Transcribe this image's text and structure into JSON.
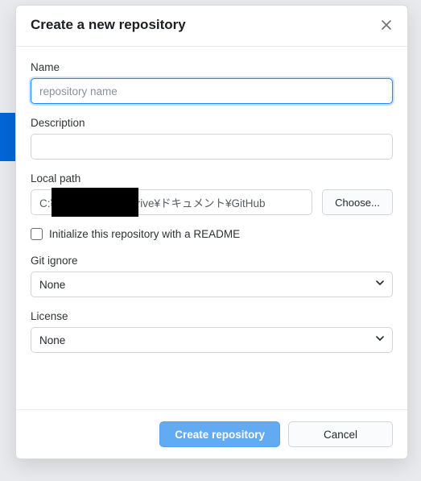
{
  "dialog": {
    "title": "Create a new repository",
    "name": {
      "label": "Name",
      "placeholder": "repository name",
      "value": ""
    },
    "description": {
      "label": "Description",
      "value": ""
    },
    "local_path": {
      "label": "Local path",
      "value": "C:¥                      eDrive¥ドキュメント¥GitHub",
      "choose_label": "Choose..."
    },
    "readme": {
      "label": "Initialize this repository with a README",
      "checked": false
    },
    "git_ignore": {
      "label": "Git ignore",
      "value": "None"
    },
    "license": {
      "label": "License",
      "value": "None"
    },
    "actions": {
      "create": "Create repository",
      "cancel": "Cancel"
    }
  }
}
